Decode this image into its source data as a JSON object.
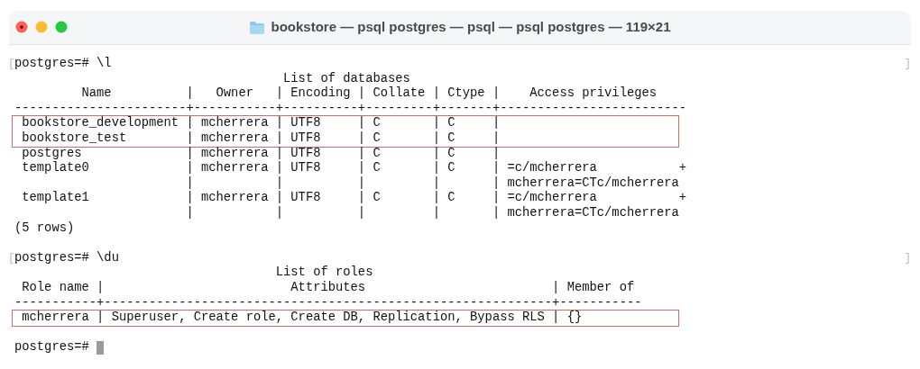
{
  "window": {
    "title": "bookstore — psql postgres — psql — psql postgres — 119×21"
  },
  "lines": [
    {
      "kind": "text",
      "text": "postgres=# \\l",
      "marked": true
    },
    {
      "kind": "text",
      "text": "                                    List of databases"
    },
    {
      "kind": "text",
      "text": "         Name          |   Owner   | Encoding | Collate | Ctype |    Access privileges"
    },
    {
      "kind": "text",
      "text": "-----------------------+-----------+----------+---------+-------+-------------------------"
    },
    {
      "kind": "text",
      "text": " bookstore_development | mcherrera | UTF8     | C       | C     |",
      "highlighted": true
    },
    {
      "kind": "text",
      "text": " bookstore_test        | mcherrera | UTF8     | C       | C     |",
      "highlighted": true
    },
    {
      "kind": "text",
      "text": " postgres              | mcherrera | UTF8     | C       | C     |"
    },
    {
      "kind": "text",
      "text": " template0             | mcherrera | UTF8     | C       | C     | =c/mcherrera           +"
    },
    {
      "kind": "text",
      "text": "                       |           |          |         |       | mcherrera=CTc/mcherrera"
    },
    {
      "kind": "text",
      "text": " template1             | mcherrera | UTF8     | C       | C     | =c/mcherrera           +"
    },
    {
      "kind": "text",
      "text": "                       |           |          |         |       | mcherrera=CTc/mcherrera"
    },
    {
      "kind": "text",
      "text": "(5 rows)"
    },
    {
      "kind": "blank"
    },
    {
      "kind": "text",
      "text": "postgres=# \\du",
      "marked": true
    },
    {
      "kind": "text",
      "text": "                                   List of roles"
    },
    {
      "kind": "text",
      "text": " Role name |                         Attributes                         | Member of"
    },
    {
      "kind": "text",
      "text": "-----------+------------------------------------------------------------+-----------"
    },
    {
      "kind": "text",
      "text": " mcherrera | Superuser, Create role, Create DB, Replication, Bypass RLS | {}",
      "highlighted": true
    },
    {
      "kind": "blank"
    },
    {
      "kind": "text",
      "text": "postgres=# ",
      "cursor": true
    }
  ]
}
